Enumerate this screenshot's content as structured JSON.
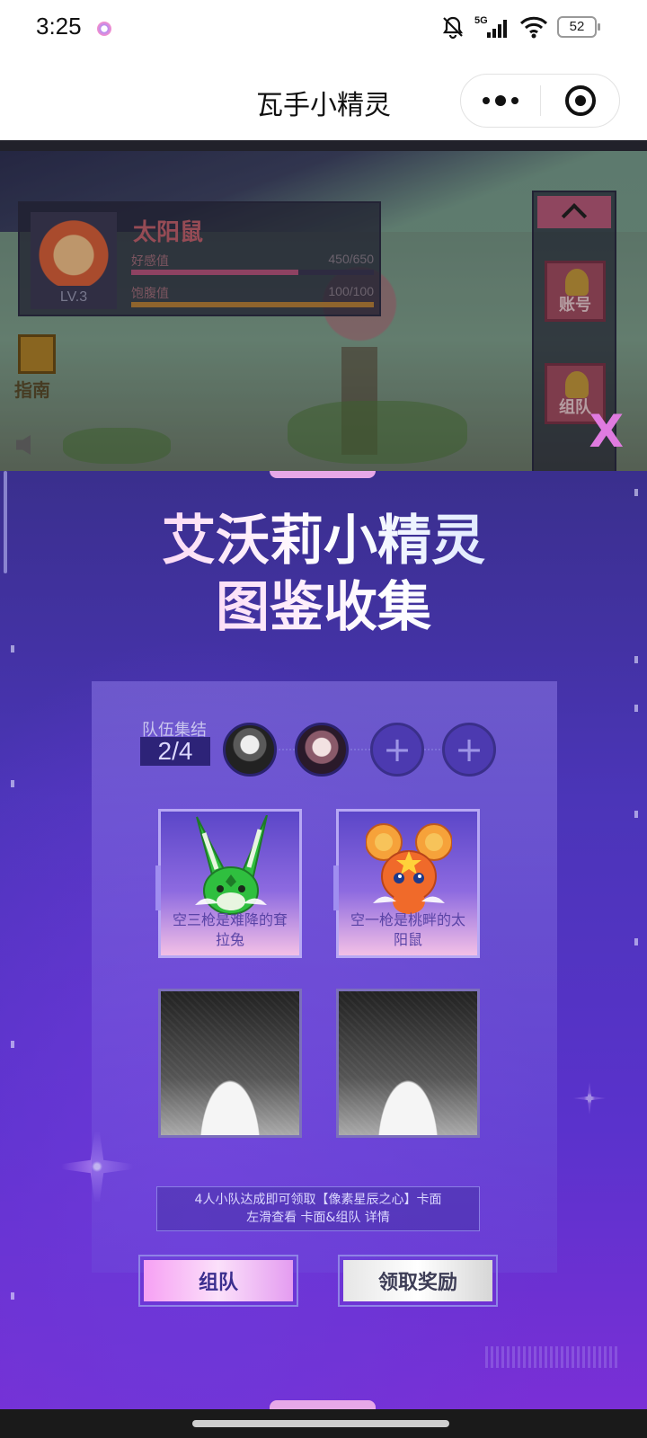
{
  "status_bar": {
    "time": "3:25",
    "network": "5G",
    "battery": "52",
    "icons": [
      "notifications-muted-icon",
      "signal-icon",
      "wifi-icon",
      "battery-icon"
    ]
  },
  "title_bar": {
    "title": "瓦手小精灵",
    "icons": [
      "more-icon",
      "close-miniapp-icon"
    ]
  },
  "game": {
    "pet": {
      "name": "太阳鼠",
      "level": "LV.3",
      "affection_label": "好感值",
      "affection_value": "450/650",
      "affection_progress": 0.69,
      "satiety_label": "饱腹值",
      "satiety_value": "100/100",
      "satiety_progress": 1.0
    },
    "side_buttons": [
      {
        "label": "账号",
        "icon": "account-icon"
      },
      {
        "label": "组队",
        "icon": "add-team-icon"
      }
    ],
    "guide_label": "指南",
    "close_label": "X"
  },
  "event": {
    "title_line1": "艾沃莉小精灵",
    "title_line2": "图鉴收集",
    "team_label": "队伍集结",
    "team_count": "2/4",
    "slots": [
      {
        "state": "filled"
      },
      {
        "state": "filled"
      },
      {
        "state": "empty",
        "symbol": "+"
      },
      {
        "state": "empty",
        "symbol": "+"
      }
    ],
    "cards": [
      {
        "name": "空三枪是难降的耷拉兔",
        "state": "unlocked",
        "color": "#2fbf3f"
      },
      {
        "name": "空一枪是桃畔的太阳鼠",
        "state": "unlocked",
        "color": "#f06a2a"
      },
      {
        "name": "",
        "state": "locked"
      },
      {
        "name": "",
        "state": "locked"
      }
    ],
    "notice_line1": "4人小队达成即可领取【像素星辰之心】卡面",
    "notice_line2": "左滑查看 卡面&组队 详情",
    "team_button": "组队",
    "reward_button": "领取奖励"
  }
}
